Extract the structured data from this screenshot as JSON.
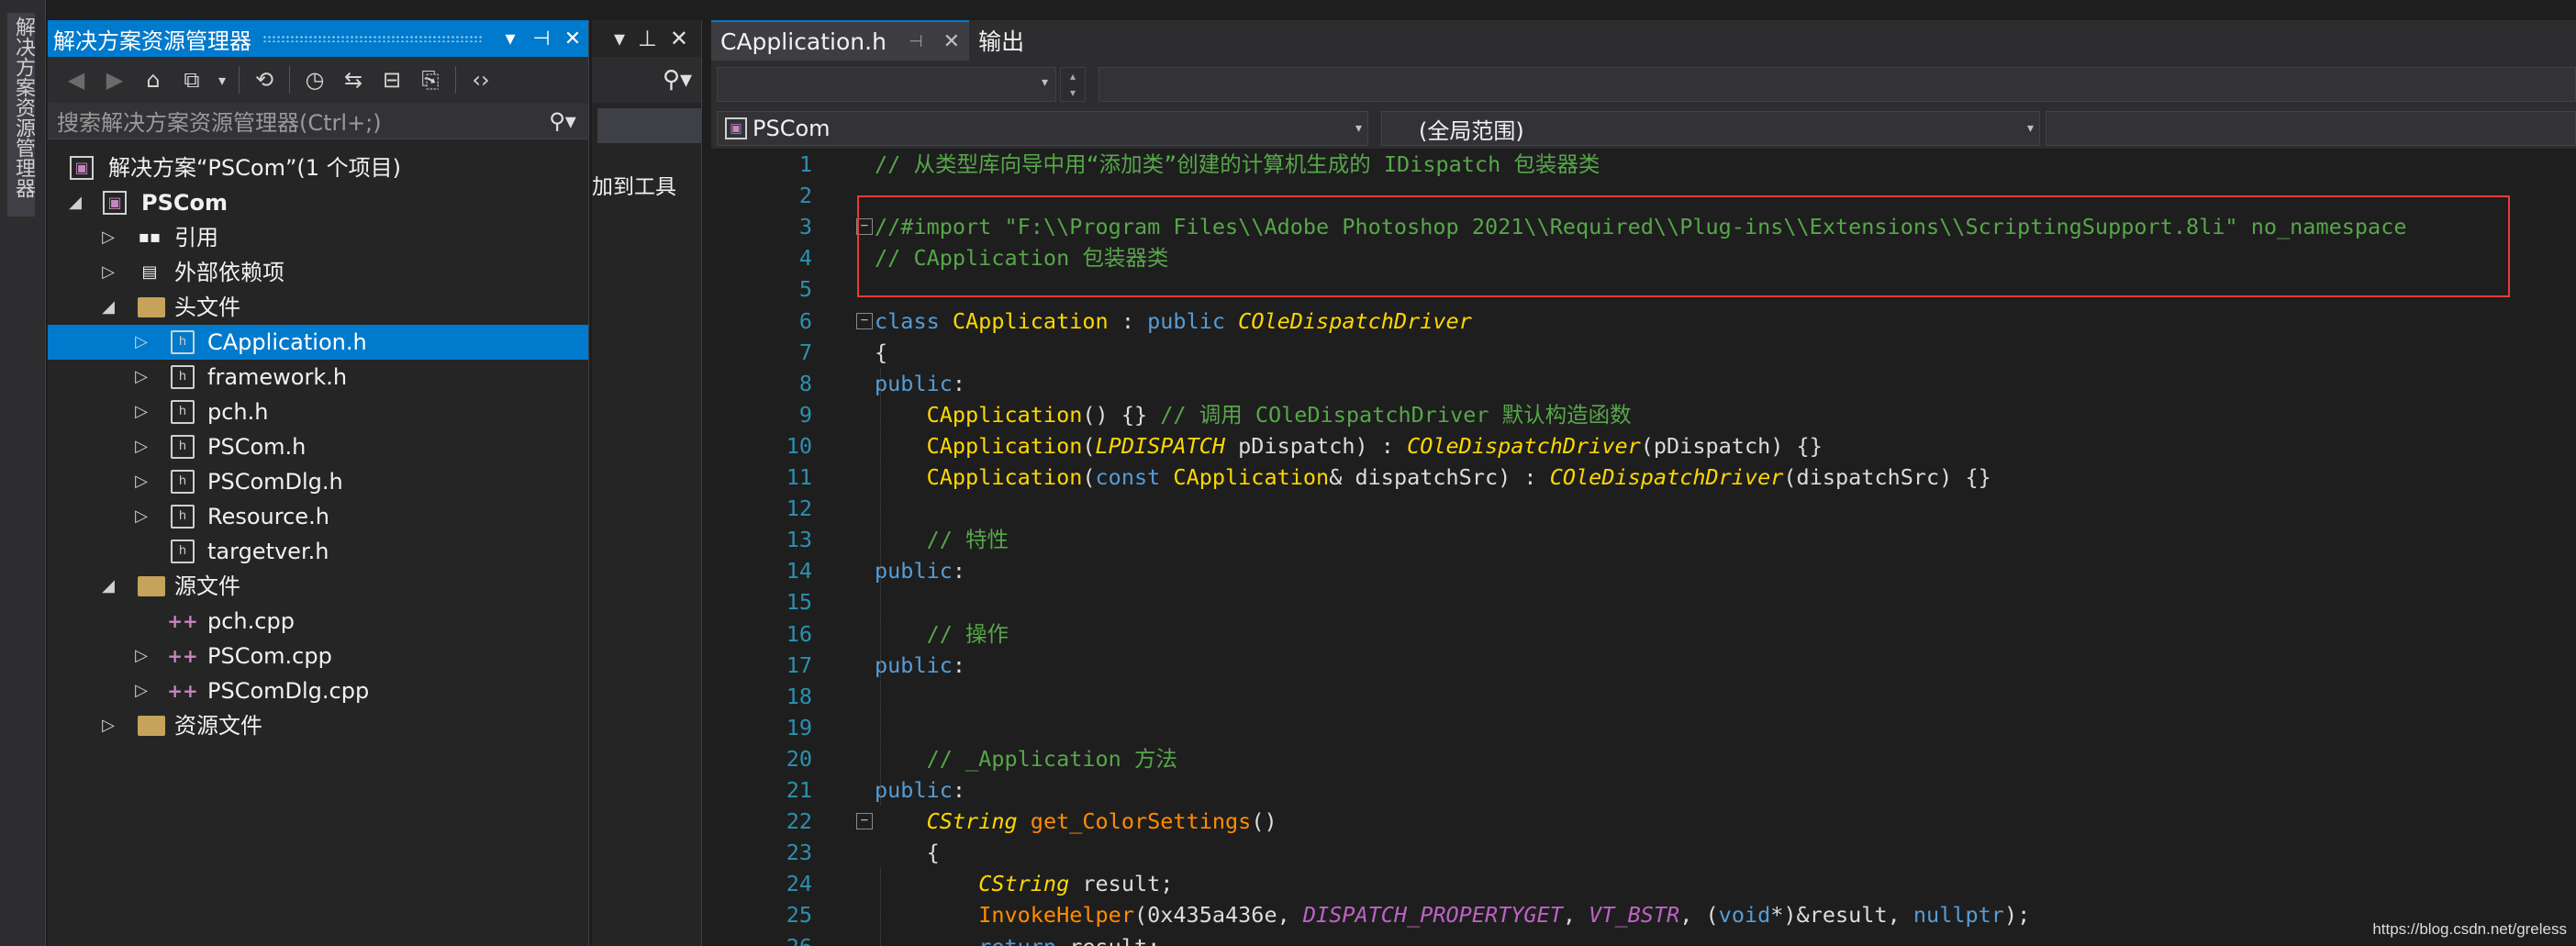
{
  "left_strip": {
    "vertical_tab": "解决方案资源管理器"
  },
  "solution_explorer": {
    "title": "解决方案资源管理器",
    "search_placeholder": "搜索解决方案资源管理器(Ctrl+;)",
    "tree": [
      {
        "label": "解决方案“PSCom”(1 个项目)",
        "icon": "solution-icon",
        "level": 0,
        "expander": ""
      },
      {
        "label": "PSCom",
        "icon": "project-icon",
        "level": 0,
        "expander": "◢"
      },
      {
        "label": "引用",
        "icon": "references-icon",
        "level": 1,
        "expander": "▷"
      },
      {
        "label": "外部依赖项",
        "icon": "external-deps-icon",
        "level": 1,
        "expander": "▷"
      },
      {
        "label": "头文件",
        "icon": "folder-icon",
        "level": 1,
        "expander": "◢"
      },
      {
        "label": "CApplication.h",
        "icon": "header-file-icon",
        "level": 2,
        "expander": "▷",
        "selected": true
      },
      {
        "label": "framework.h",
        "icon": "header-file-icon",
        "level": 2,
        "expander": "▷"
      },
      {
        "label": "pch.h",
        "icon": "header-file-icon",
        "level": 2,
        "expander": "▷"
      },
      {
        "label": "PSCom.h",
        "icon": "header-file-icon",
        "level": 2,
        "expander": "▷"
      },
      {
        "label": "PSComDlg.h",
        "icon": "header-file-icon",
        "level": 2,
        "expander": "▷"
      },
      {
        "label": "Resource.h",
        "icon": "header-file-icon",
        "level": 2,
        "expander": "▷"
      },
      {
        "label": "targetver.h",
        "icon": "header-file-icon",
        "level": 2,
        "expander": ""
      },
      {
        "label": "源文件",
        "icon": "folder-icon",
        "level": 1,
        "expander": "◢"
      },
      {
        "label": "pch.cpp",
        "icon": "cpp-file-icon",
        "level": 2,
        "expander": ""
      },
      {
        "label": "PSCom.cpp",
        "icon": "cpp-file-icon",
        "level": 2,
        "expander": "▷"
      },
      {
        "label": "PSComDlg.cpp",
        "icon": "cpp-file-icon",
        "level": 2,
        "expander": "▷"
      },
      {
        "label": "资源文件",
        "icon": "folder-icon",
        "level": 1,
        "expander": "▷"
      }
    ]
  },
  "mid_pane": {
    "label": "加到工具"
  },
  "editor": {
    "tabs": [
      {
        "label": "CApplication.h",
        "active": true
      },
      {
        "label": "输出",
        "active": false
      }
    ],
    "nav_project": "PSCom",
    "nav_scope": "(全局范围)"
  },
  "code_lines": [
    {
      "n": "1",
      "tokens": [
        [
          "cm",
          "// 从类型库向导中用“添加类”创建的计算机生成的 IDispatch 包装器类"
        ]
      ]
    },
    {
      "n": "2",
      "tokens": []
    },
    {
      "n": "3",
      "tokens": [
        [
          "cm",
          "//#import \"F:\\\\Program Files\\\\Adobe Photoshop 2021\\\\Required\\\\Plug-ins\\\\Extensions\\\\ScriptingSupport.8li\" no_namespace"
        ]
      ],
      "fold": "true"
    },
    {
      "n": "4",
      "tokens": [
        [
          "cm",
          "// CApplication 包装器类"
        ]
      ]
    },
    {
      "n": "5",
      "tokens": []
    },
    {
      "n": "6",
      "tokens": [
        [
          "kw",
          "class "
        ],
        [
          "cls",
          "CApplication"
        ],
        [
          "pl",
          " : "
        ],
        [
          "kw",
          "public "
        ],
        [
          "ty",
          "COleDispatchDriver"
        ]
      ],
      "fold": "true"
    },
    {
      "n": "7",
      "tokens": [
        [
          "pl",
          "{"
        ]
      ]
    },
    {
      "n": "8",
      "tokens": [
        [
          "kw",
          "public"
        ],
        [
          "pl",
          ":"
        ]
      ]
    },
    {
      "n": "9",
      "tokens": [
        [
          "pl",
          "    "
        ],
        [
          "cls",
          "CApplication"
        ],
        [
          "pl",
          "() {} "
        ],
        [
          "cm",
          "// 调用 COleDispatchDriver 默认构造函数"
        ]
      ]
    },
    {
      "n": "10",
      "tokens": [
        [
          "pl",
          "    "
        ],
        [
          "cls",
          "CApplication"
        ],
        [
          "pl",
          "("
        ],
        [
          "ty",
          "LPDISPATCH"
        ],
        [
          "pl",
          " pDispatch) : "
        ],
        [
          "ty",
          "COleDispatchDriver"
        ],
        [
          "pl",
          "(pDispatch) {}"
        ]
      ]
    },
    {
      "n": "11",
      "tokens": [
        [
          "pl",
          "    "
        ],
        [
          "cls",
          "CApplication"
        ],
        [
          "pl",
          "("
        ],
        [
          "kw",
          "const "
        ],
        [
          "cls",
          "CApplication"
        ],
        [
          "pl",
          "& dispatchSrc) : "
        ],
        [
          "ty",
          "COleDispatchDriver"
        ],
        [
          "pl",
          "(dispatchSrc) {}"
        ]
      ]
    },
    {
      "n": "12",
      "tokens": []
    },
    {
      "n": "13",
      "tokens": [
        [
          "pl",
          "    "
        ],
        [
          "cm",
          "// 特性"
        ]
      ]
    },
    {
      "n": "14",
      "tokens": [
        [
          "kw",
          "public"
        ],
        [
          "pl",
          ":"
        ]
      ]
    },
    {
      "n": "15",
      "tokens": []
    },
    {
      "n": "16",
      "tokens": [
        [
          "pl",
          "    "
        ],
        [
          "cm",
          "// 操作"
        ]
      ]
    },
    {
      "n": "17",
      "tokens": [
        [
          "kw",
          "public"
        ],
        [
          "pl",
          ":"
        ]
      ]
    },
    {
      "n": "18",
      "tokens": []
    },
    {
      "n": "19",
      "tokens": []
    },
    {
      "n": "20",
      "tokens": [
        [
          "pl",
          "    "
        ],
        [
          "cm",
          "// _Application 方法"
        ]
      ]
    },
    {
      "n": "21",
      "tokens": [
        [
          "kw",
          "public"
        ],
        [
          "pl",
          ":"
        ]
      ]
    },
    {
      "n": "22",
      "tokens": [
        [
          "pl",
          "    "
        ],
        [
          "ty",
          "CString"
        ],
        [
          "pl",
          " "
        ],
        [
          "fn",
          "get_ColorSettings"
        ],
        [
          "pl",
          "()"
        ]
      ],
      "fold": "true"
    },
    {
      "n": "23",
      "tokens": [
        [
          "pl",
          "    {"
        ]
      ]
    },
    {
      "n": "24",
      "tokens": [
        [
          "pl",
          "        "
        ],
        [
          "ty",
          "CString"
        ],
        [
          "pl",
          " result;"
        ]
      ]
    },
    {
      "n": "25",
      "tokens": [
        [
          "pl",
          "        "
        ],
        [
          "fn",
          "InvokeHelper"
        ],
        [
          "pl",
          "(0x435a436e, "
        ],
        [
          "mac",
          "DISPATCH_PROPERTYGET"
        ],
        [
          "pl",
          ", "
        ],
        [
          "mac",
          "VT_BSTR"
        ],
        [
          "pl",
          ", ("
        ],
        [
          "kw",
          "void"
        ],
        [
          "pl",
          "*)&result, "
        ],
        [
          "kw",
          "nullptr"
        ],
        [
          "pl",
          ");"
        ]
      ]
    },
    {
      "n": "26",
      "tokens": [
        [
          "pl",
          "        "
        ],
        [
          "kw",
          "return"
        ],
        [
          "pl",
          " result;"
        ]
      ]
    }
  ],
  "watermark": "https://blog.csdn.net/greless",
  "colors": {
    "accent": "#007acc",
    "comment": "#57a64a",
    "keyword": "#569cd6",
    "class": "#ffd700",
    "function": "#ff8c00",
    "macro": "#bd63c5",
    "annotation_box": "#e83a3a"
  }
}
